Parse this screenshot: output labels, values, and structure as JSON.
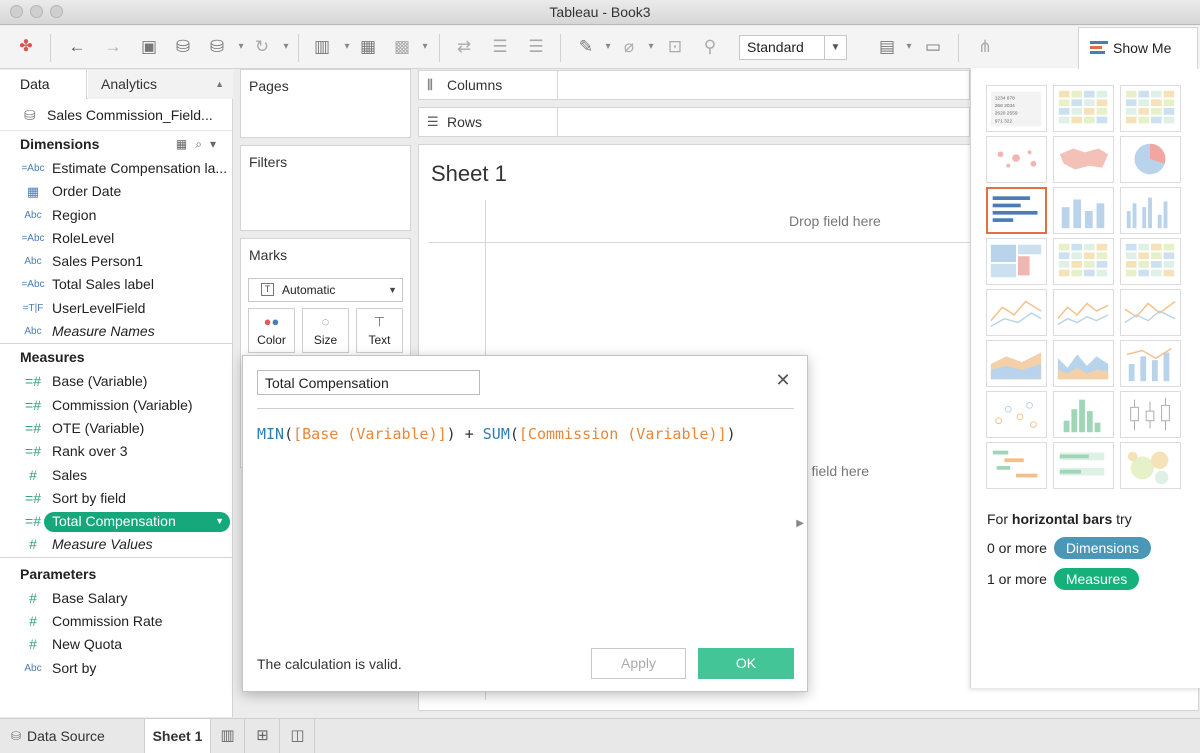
{
  "window": {
    "title": "Tableau - Book3"
  },
  "toolbar": {
    "view_mode": "Standard",
    "show_me_label": "Show Me",
    "icons": [
      "tableau-logo-icon",
      "undo-icon",
      "redo-icon",
      "save-icon",
      "new-datasource-icon",
      "pause-updates-icon",
      "refresh-icon",
      "new-worksheet-icon",
      "duplicate-sheet-icon",
      "clear-sheet-icon",
      "swap-rows-columns-icon",
      "sort-ascending-icon",
      "sort-descending-icon",
      "highlight-icon",
      "group-icon",
      "show-labels-icon",
      "fix-axes-icon",
      "fit-dropdown-icon",
      "presentation-mode-icon",
      "share-icon"
    ]
  },
  "data_pane": {
    "tab_data": "Data",
    "tab_analytics": "Analytics",
    "datasource": "Sales Commission_Field...",
    "dimensions_header": "Dimensions",
    "dimensions": [
      {
        "type": "=Abc",
        "label": "Estimate Compensation la...",
        "italic": false
      },
      {
        "type": "date",
        "label": "Order Date",
        "italic": false
      },
      {
        "type": "Abc",
        "label": "Region",
        "italic": false
      },
      {
        "type": "=Abc",
        "label": "RoleLevel",
        "italic": false
      },
      {
        "type": "Abc",
        "label": "Sales Person1",
        "italic": false
      },
      {
        "type": "=Abc",
        "label": "Total Sales label",
        "italic": false
      },
      {
        "type": "=T|F",
        "label": "UserLevelField",
        "italic": false
      },
      {
        "type": "Abc",
        "label": "Measure Names",
        "italic": true
      }
    ],
    "measures_header": "Measures",
    "measures": [
      {
        "type": "=#",
        "label": "Base (Variable)",
        "italic": false
      },
      {
        "type": "=#",
        "label": "Commission (Variable)",
        "italic": false
      },
      {
        "type": "=#",
        "label": "OTE (Variable)",
        "italic": false
      },
      {
        "type": "=#",
        "label": "Rank over 3",
        "italic": false
      },
      {
        "type": "#",
        "label": "Sales",
        "italic": false
      },
      {
        "type": "=#",
        "label": "Sort by field",
        "italic": false
      },
      {
        "type": "=#",
        "label": "Total Compensation",
        "italic": false,
        "selected": true
      },
      {
        "type": "#",
        "label": "Measure Values",
        "italic": true
      }
    ],
    "parameters_header": "Parameters",
    "parameters": [
      {
        "type": "#",
        "label": "Base Salary"
      },
      {
        "type": "#",
        "label": "Commission Rate"
      },
      {
        "type": "#",
        "label": "New Quota"
      },
      {
        "type": "Abc",
        "label": "Sort by"
      }
    ]
  },
  "cards": {
    "pages": "Pages",
    "filters": "Filters",
    "marks": "Marks",
    "mark_type": "Automatic",
    "mark_buttons": [
      {
        "label": "Color",
        "icon": "color-icon"
      },
      {
        "label": "Size",
        "icon": "size-icon"
      },
      {
        "label": "Text",
        "icon": "text-icon"
      }
    ]
  },
  "shelves": {
    "columns": "Columns",
    "rows": "Rows"
  },
  "sheet": {
    "title": "Sheet 1",
    "drop_top": "Drop field here",
    "drop_mid": "op field here"
  },
  "show_me": {
    "hint_prefix": "For ",
    "hint_bold": "horizontal bars",
    "hint_suffix": " try",
    "dim_req": "0 or more",
    "dim_badge": "Dimensions",
    "meas_req": "1 or more",
    "meas_badge": "Measures",
    "dim_color": "#4a97b8",
    "meas_color": "#16b07a",
    "selected_chart": "horizontal bars"
  },
  "calc_dialog": {
    "name": "Total Compensation",
    "formula": [
      {
        "t": "MIN",
        "k": "fn"
      },
      {
        "t": "(",
        "k": "p"
      },
      {
        "t": "[Base (Variable)]",
        "k": "fld"
      },
      {
        "t": ") + ",
        "k": "p"
      },
      {
        "t": "SUM",
        "k": "fn"
      },
      {
        "t": "(",
        "k": "p"
      },
      {
        "t": "[Commission (Variable)]",
        "k": "fld"
      },
      {
        "t": ")",
        "k": "p"
      }
    ],
    "status": "The calculation is valid.",
    "apply": "Apply",
    "ok": "OK"
  },
  "bottom_tabs": {
    "datasource": "Data Source",
    "sheet": "Sheet 1"
  }
}
